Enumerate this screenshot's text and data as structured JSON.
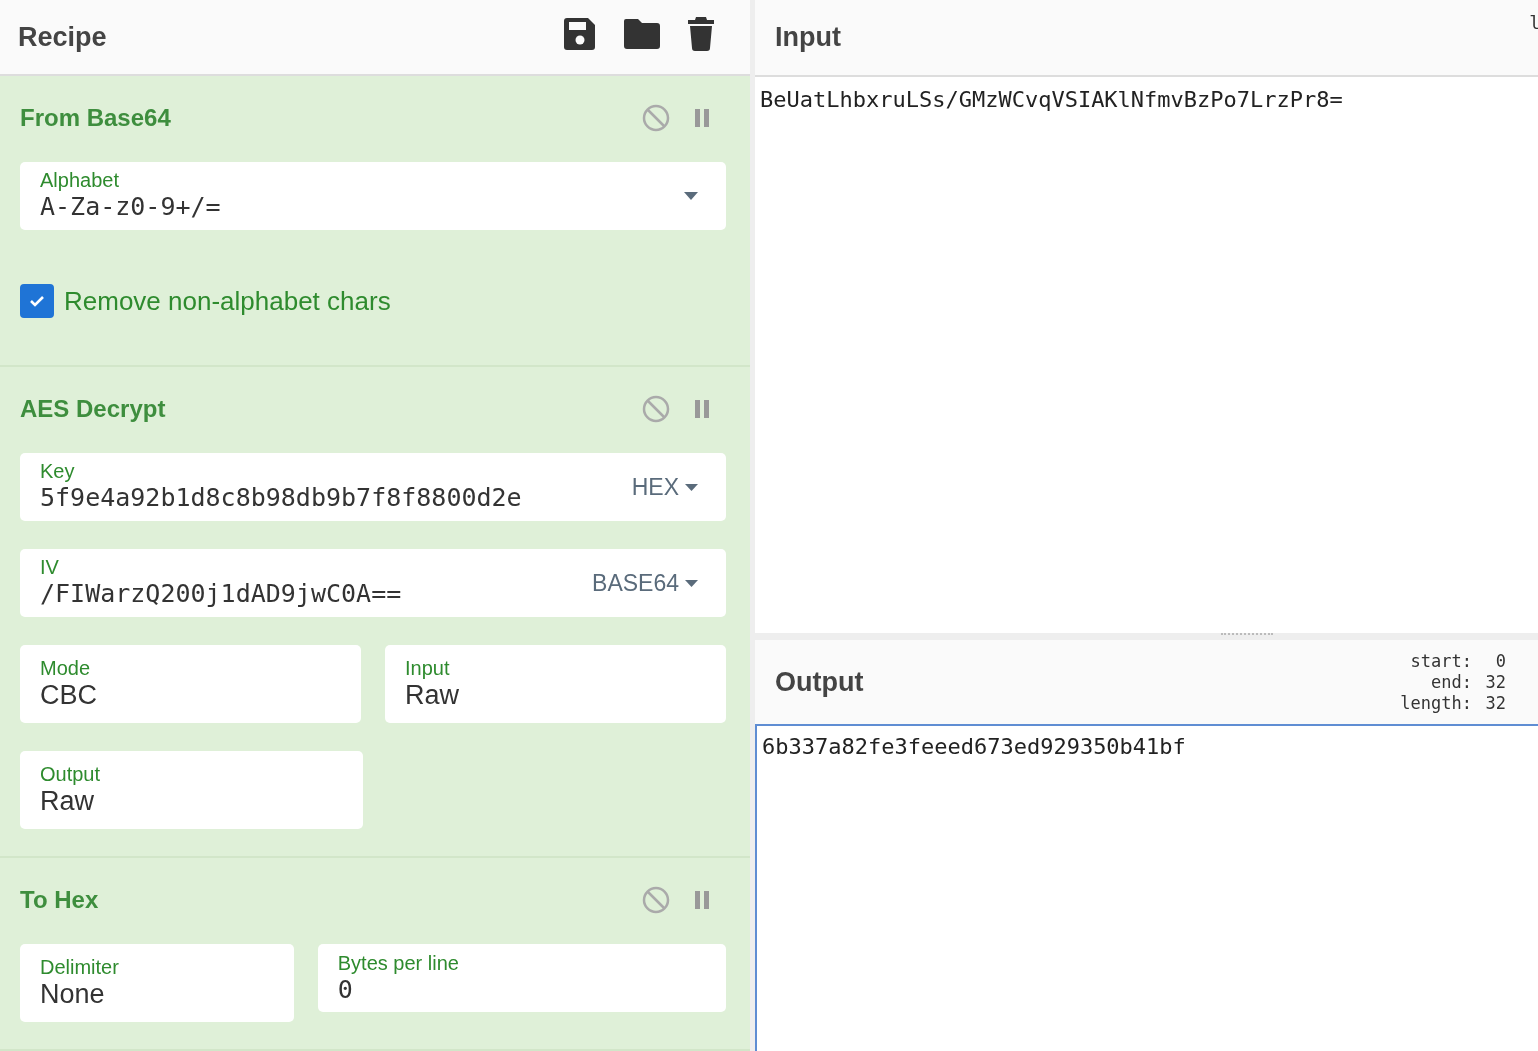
{
  "recipe": {
    "title": "Recipe"
  },
  "operations": [
    {
      "title": "From Base64",
      "rows": [
        {
          "fields": [
            {
              "kind": "dropdown",
              "label": "Alphabet",
              "value": "A-Za-z0-9+/="
            }
          ]
        },
        {
          "fields": [
            {
              "kind": "checkbox",
              "label": "Remove non-alphabet chars",
              "checked": true
            }
          ]
        }
      ]
    },
    {
      "title": "AES Decrypt",
      "rows": [
        {
          "fields": [
            {
              "kind": "toggle-string",
              "label": "Key",
              "value": "5f9e4a92b1d8c8b98db9b7f8f8800d2e",
              "option": "HEX"
            }
          ]
        },
        {
          "fields": [
            {
              "kind": "toggle-string",
              "label": "IV",
              "value": "/FIWarzQ200j1dAD9jwC0A==",
              "option": "BASE64"
            }
          ]
        },
        {
          "fields": [
            {
              "kind": "select",
              "label": "Mode",
              "value": "CBC"
            },
            {
              "kind": "select",
              "label": "Input",
              "value": "Raw"
            }
          ]
        },
        {
          "fields": [
            {
              "kind": "select",
              "label": "Output",
              "value": "Raw"
            }
          ]
        }
      ]
    },
    {
      "title": "To Hex",
      "rows": [
        {
          "fields": [
            {
              "kind": "select",
              "label": "Delimiter",
              "value": "None"
            },
            {
              "kind": "number",
              "label": "Bytes per line",
              "value": "0"
            }
          ]
        }
      ]
    }
  ],
  "input": {
    "title": "Input",
    "corner": "l",
    "value": "BeUatLhbxruLSs/GMzWCvqVSIAKlNfmvBzPo7LrzPr8="
  },
  "output": {
    "title": "Output",
    "stats": [
      {
        "label": "start:",
        "value": "0"
      },
      {
        "label": "end:",
        "value": "32"
      },
      {
        "label": "length:",
        "value": "32"
      }
    ],
    "value": "6b337a82fe3feeed673ed929350b41bf"
  }
}
